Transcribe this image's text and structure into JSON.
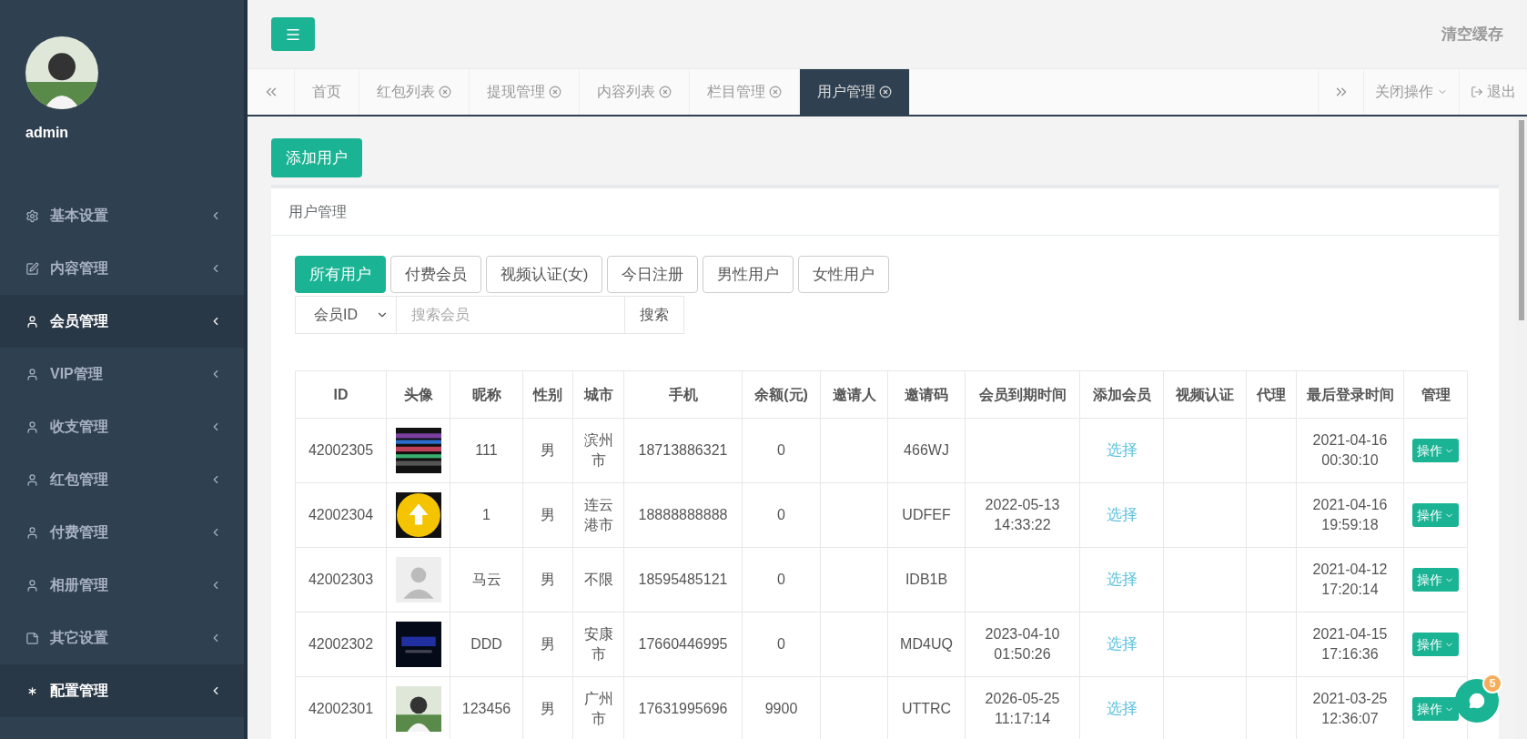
{
  "sidebar": {
    "user": {
      "name": "admin"
    },
    "items": [
      {
        "label": "基本设置",
        "active": false
      },
      {
        "label": "内容管理",
        "active": false
      },
      {
        "label": "会员管理",
        "active": true
      },
      {
        "label": "VIP管理",
        "active": false
      },
      {
        "label": "收支管理",
        "active": false
      },
      {
        "label": "红包管理",
        "active": false
      },
      {
        "label": "付费管理",
        "active": false
      },
      {
        "label": "相册管理",
        "active": false
      },
      {
        "label": "其它设置",
        "active": false
      },
      {
        "label": "配置管理",
        "active": true
      }
    ]
  },
  "header": {
    "clear_cache": "清空缓存"
  },
  "tabs": [
    {
      "label": "首页",
      "closable": false,
      "selected": false
    },
    {
      "label": "红包列表",
      "closable": true,
      "selected": false
    },
    {
      "label": "提现管理",
      "closable": true,
      "selected": false
    },
    {
      "label": "内容列表",
      "closable": true,
      "selected": false
    },
    {
      "label": "栏目管理",
      "closable": true,
      "selected": false
    },
    {
      "label": "用户管理",
      "closable": true,
      "selected": true
    }
  ],
  "tab_actions": {
    "close_ops": "关闭操作",
    "logout": "退出"
  },
  "add_button": "添加用户",
  "panel": {
    "title": "用户管理",
    "filters": [
      {
        "label": "所有用户",
        "selected": true
      },
      {
        "label": "付费会员",
        "selected": false
      },
      {
        "label": "视频认证(女)",
        "selected": false
      },
      {
        "label": "今日注册",
        "selected": false
      },
      {
        "label": "男性用户",
        "selected": false
      },
      {
        "label": "女性用户",
        "selected": false
      }
    ],
    "search": {
      "field": "会员ID",
      "placeholder": "搜索会员",
      "button": "搜索"
    },
    "table": {
      "columns": [
        "ID",
        "头像",
        "昵称",
        "性别",
        "城市",
        "手机",
        "余额(元)",
        "邀请人",
        "邀请码",
        "会员到期时间",
        "添加会员",
        "视频认证",
        "代理",
        "最后登录时间",
        "管理"
      ],
      "rows": [
        {
          "id": "42002305",
          "nickname": "111",
          "gender": "男",
          "city": "滨州市",
          "phone": "18713886321",
          "balance": "0",
          "code": "466WJ",
          "add": "选择",
          "last_login": [
            "2021-04-16",
            "00:30:10"
          ],
          "action": "操作"
        },
        {
          "id": "42002304",
          "nickname": "1",
          "gender": "男",
          "city": "连云港市",
          "phone": "18888888888",
          "balance": "0",
          "code": "UDFEF",
          "expiry": [
            "2022-05-13",
            "14:33:22"
          ],
          "add": "选择",
          "last_login": [
            "2021-04-16",
            "19:59:18"
          ],
          "action": "操作"
        },
        {
          "id": "42002303",
          "nickname": "马云",
          "gender": "男",
          "city": "不限",
          "phone": "18595485121",
          "balance": "0",
          "code": "IDB1B",
          "add": "选择",
          "last_login": [
            "2021-04-12",
            "17:20:14"
          ],
          "action": "操作"
        },
        {
          "id": "42002302",
          "nickname": "DDD",
          "gender": "男",
          "city": "安康市",
          "phone": "17660446995",
          "balance": "0",
          "code": "MD4UQ",
          "expiry": [
            "2023-04-10",
            "01:50:26"
          ],
          "add": "选择",
          "last_login": [
            "2021-04-15",
            "17:16:36"
          ],
          "action": "操作"
        },
        {
          "id": "42002301",
          "nickname": "123456",
          "gender": "男",
          "city": "广州市",
          "phone": "17631995696",
          "balance": "9900",
          "code": "UTTRC",
          "expiry": [
            "2026-05-25",
            "11:17:14"
          ],
          "add": "选择",
          "last_login": [
            "2021-03-25",
            "12:36:07"
          ],
          "action": "操作"
        }
      ]
    }
  },
  "chat": {
    "badge": "5"
  }
}
